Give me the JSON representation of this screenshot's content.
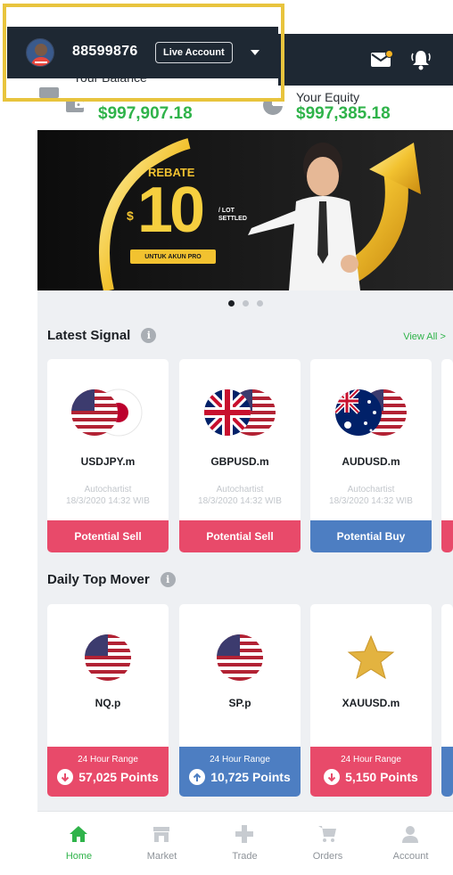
{
  "account": {
    "number": "88599876",
    "type_label": "Live Account"
  },
  "balance": {
    "label": "Your Balance",
    "value": "$997,907.18"
  },
  "equity": {
    "label": "Your Equity",
    "value": "$997,385.18"
  },
  "banner": {
    "headline": "REBATE",
    "currency": "$",
    "amount": "10",
    "unit_line1": "/ LOT",
    "unit_line2": "SETTLED",
    "tagline": "UNTUK AKUN PRO"
  },
  "carousel": {
    "pages": 3,
    "active": 0
  },
  "latest_signal": {
    "title": "Latest Signal",
    "info_icon": "i",
    "view_all": "View All >",
    "items": [
      {
        "symbol": "USDJPY.m",
        "source": "Autochartist",
        "time": "18/3/2020 14:32 WIB",
        "action": "Potential Sell",
        "kind": "sell",
        "flags": [
          "us-flag-icon",
          "jp-flag-icon"
        ]
      },
      {
        "symbol": "GBPUSD.m",
        "source": "Autochartist",
        "time": "18/3/2020 14:32 WIB",
        "action": "Potential Sell",
        "kind": "sell",
        "flags": [
          "uk-flag-icon",
          "us-flag-icon"
        ]
      },
      {
        "symbol": "AUDUSD.m",
        "source": "Autochartist",
        "time": "18/3/2020 14:32 WIB",
        "action": "Potential Buy",
        "kind": "buy",
        "flags": [
          "au-flag-icon",
          "us-flag-icon"
        ]
      }
    ]
  },
  "top_mover": {
    "title": "Daily Top Mover",
    "info_icon": "i",
    "items": [
      {
        "symbol": "NQ.p",
        "range_label": "24 Hour Range",
        "points": "57,025 Points",
        "direction": "down",
        "icon": "us-flag-icon"
      },
      {
        "symbol": "SP.p",
        "range_label": "24 Hour Range",
        "points": "10,725 Points",
        "direction": "up",
        "icon": "us-flag-icon"
      },
      {
        "symbol": "XAUUSD.m",
        "range_label": "24 Hour Range",
        "points": "5,150 Points",
        "direction": "down",
        "icon": "gold-star-icon"
      }
    ]
  },
  "nav": [
    {
      "label": "Home",
      "icon": "home-icon",
      "active": true
    },
    {
      "label": "Market",
      "icon": "market-icon",
      "active": false
    },
    {
      "label": "Trade",
      "icon": "plus-icon",
      "active": false
    },
    {
      "label": "Orders",
      "icon": "cart-icon",
      "active": false
    },
    {
      "label": "Account",
      "icon": "user-icon",
      "active": false
    }
  ],
  "colors": {
    "accent": "#2fb34a",
    "sell": "#e84a6a",
    "buy": "#4d7ec2",
    "header": "#1e2833",
    "highlight": "#e8c43d"
  }
}
